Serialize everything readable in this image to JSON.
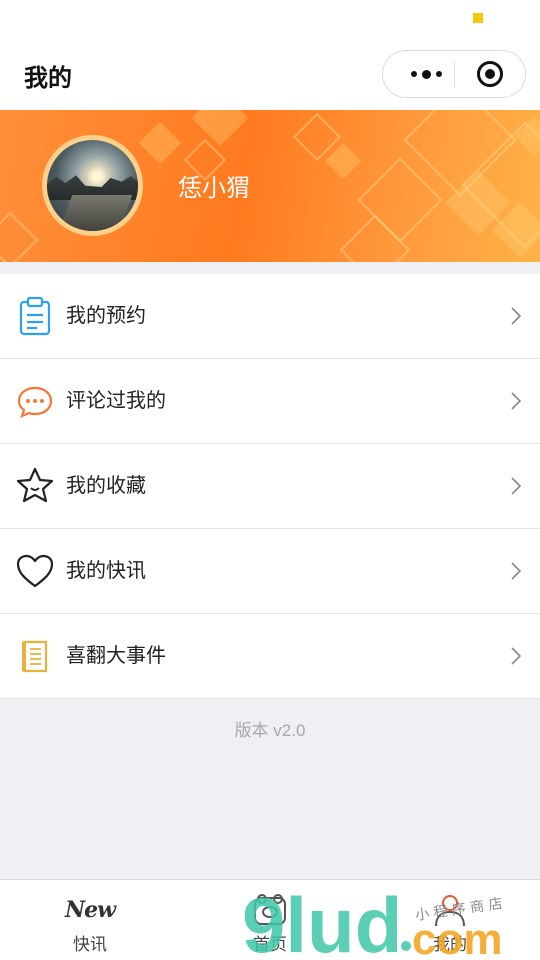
{
  "nav": {
    "title": "我的"
  },
  "profile": {
    "username": "恁小猬"
  },
  "menu": [
    {
      "label": "我的预约",
      "icon": "clipboard-icon"
    },
    {
      "label": "评论过我的",
      "icon": "comment-icon"
    },
    {
      "label": "我的收藏",
      "icon": "star-icon"
    },
    {
      "label": "我的快讯",
      "icon": "heart-icon"
    },
    {
      "label": "喜翻大事件",
      "icon": "notebook-icon"
    }
  ],
  "version": "版本 v2.0",
  "tabbar": {
    "tabs": [
      {
        "label": "快讯",
        "icon_text": "New",
        "icon": "new-logo-icon"
      },
      {
        "label": "首页",
        "icon": "home-icon"
      },
      {
        "label": "我的",
        "icon": "profile-icon"
      }
    ]
  },
  "watermark": {
    "text": "小 程 序 商 店"
  },
  "colors": {
    "accent": "#ff8a2b",
    "background": "#efeff4",
    "icon_blue": "#2b9ef5",
    "icon_orange": "#f5763a",
    "icon_gold": "#e9b23a"
  }
}
